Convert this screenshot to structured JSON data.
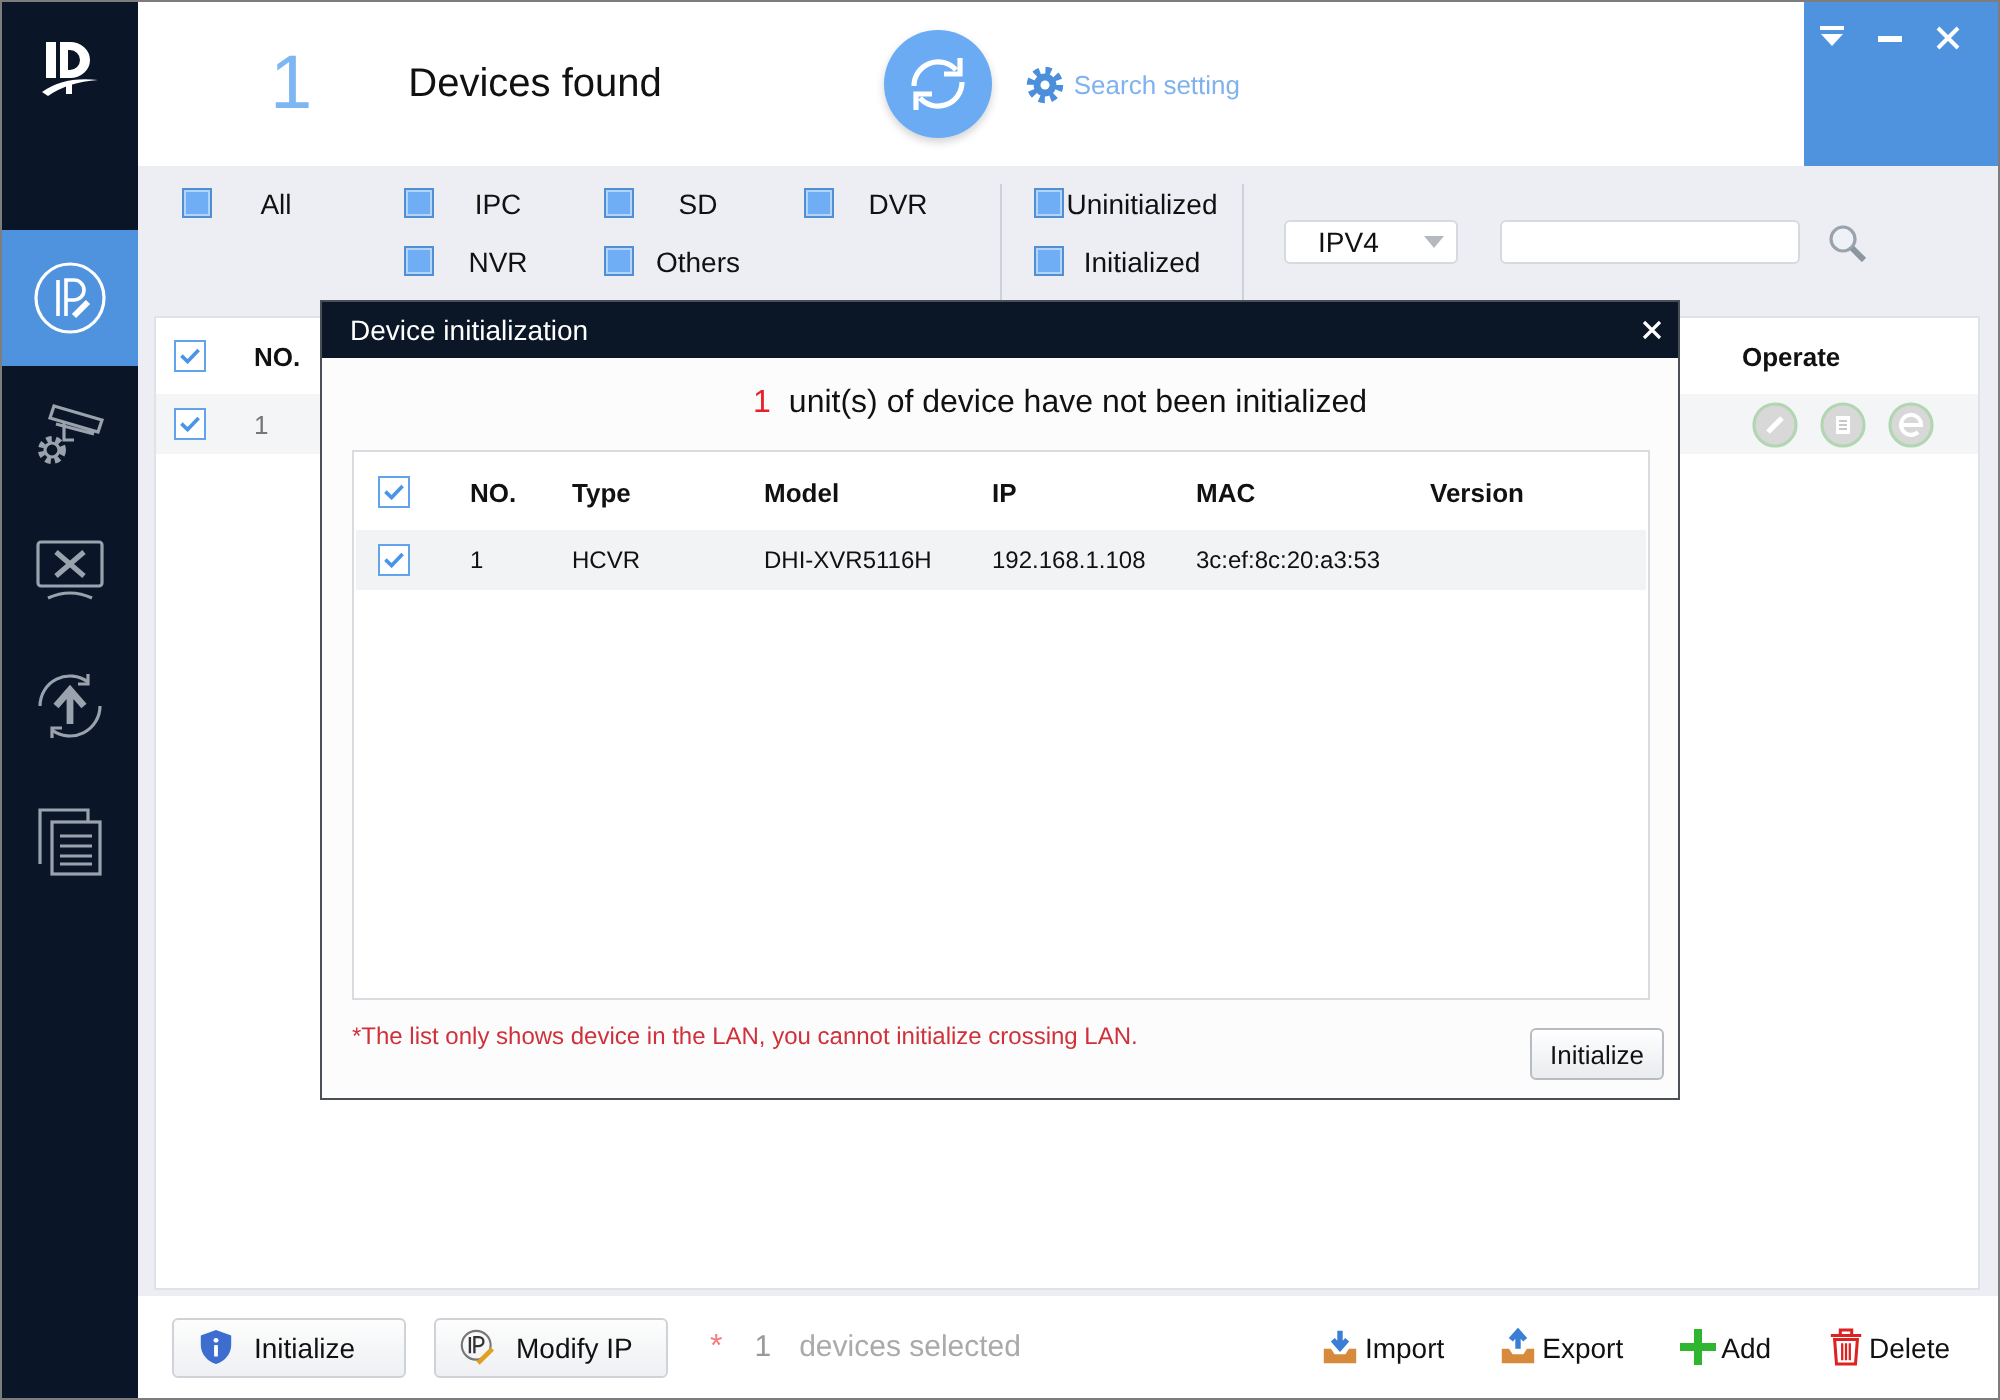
{
  "sidebar": {
    "items": [
      {
        "kind": "ip",
        "selected": true
      },
      {
        "kind": "camera",
        "selected": false
      },
      {
        "kind": "tools",
        "selected": false
      },
      {
        "kind": "upgrade",
        "selected": false
      },
      {
        "kind": "files",
        "selected": false
      }
    ]
  },
  "header": {
    "count": "1",
    "title": "Devices found",
    "search_setting": "Search setting"
  },
  "filters": {
    "types": [
      {
        "label": "All",
        "checked": true
      },
      {
        "label": "IPC",
        "checked": true
      },
      {
        "label": "SD",
        "checked": true
      },
      {
        "label": "DVR",
        "checked": true
      },
      {
        "label": "NVR",
        "checked": true
      },
      {
        "label": "Others",
        "checked": true
      }
    ],
    "status": [
      {
        "label": "Uninitialized",
        "checked": true
      },
      {
        "label": "Initialized",
        "checked": true
      }
    ],
    "protocol": "IPV4"
  },
  "device_table": {
    "all_checked": true,
    "columns": [
      "NO.",
      "Operate"
    ],
    "rows": [
      {
        "checked": true,
        "no": "1"
      }
    ]
  },
  "footer": {
    "buttons": [
      {
        "kind": "initialize",
        "label": "Initialize"
      },
      {
        "kind": "modify_ip",
        "label": "Modify IP"
      }
    ],
    "selection": {
      "mark": "*",
      "count": "1",
      "label": "devices selected"
    },
    "actions": [
      {
        "kind": "import",
        "label": "Import"
      },
      {
        "kind": "export",
        "label": "Export"
      },
      {
        "kind": "add",
        "label": "Add"
      },
      {
        "kind": "delete",
        "label": "Delete"
      }
    ]
  },
  "dialog": {
    "title": "Device initialization",
    "count": "1",
    "message": "unit(s) of device have not been initialized",
    "table": {
      "all_checked": true,
      "columns": [
        "NO.",
        "Type",
        "Model",
        "IP",
        "MAC",
        "Version"
      ],
      "rows": [
        {
          "checked": true,
          "cells": [
            "1",
            "HCVR",
            "DHI-XVR5116H",
            "192.168.1.108",
            "3c:ef:8c:20:a3:53"
          ]
        }
      ]
    },
    "note": "*The list only shows device in the LAN, you cannot initialize crossing LAN.",
    "button": "Initialize"
  }
}
